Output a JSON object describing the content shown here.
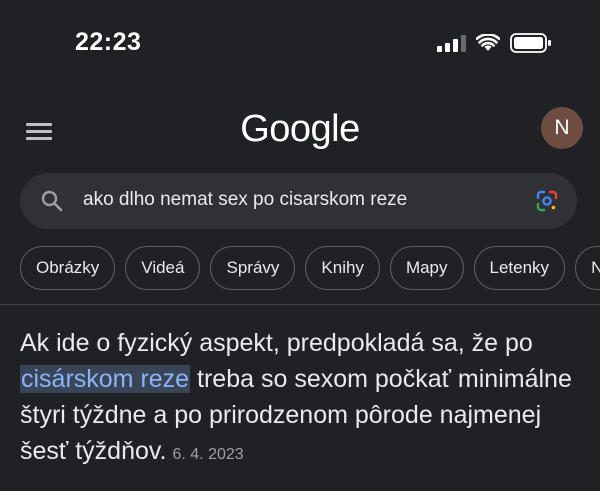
{
  "status_bar": {
    "time": "22:23",
    "icons": [
      "cellular-signal-icon",
      "wifi-icon",
      "battery-icon"
    ]
  },
  "header": {
    "logo_text": "Google",
    "avatar_initial": "N",
    "avatar_color": "#6d4c41",
    "menu_icon": "hamburger-menu-icon"
  },
  "search": {
    "query": "ako dlho nemat sex po cisarskom reze",
    "icons": [
      "search-icon",
      "google-lens-icon"
    ]
  },
  "chips": [
    {
      "label": "Obrázky"
    },
    {
      "label": "Videá"
    },
    {
      "label": "Správy"
    },
    {
      "label": "Knihy"
    },
    {
      "label": "Mapy"
    },
    {
      "label": "Letenky"
    },
    {
      "label": "Nákupy"
    }
  ],
  "snippet": {
    "before": "Ak ide o fyzický aspekt, predpokladá sa, že po ",
    "highlight": "cisárskom reze",
    "after": " treba so sexom počkať minimálne štyri týždne a po prirodzenom pôrode najmenej šesť týždňov.",
    "date": "6. 4. 2023",
    "highlight_color": "#8ab4f8"
  },
  "colors": {
    "background": "#202124",
    "search_bg": "#303134",
    "chip_border": "#5f6368"
  }
}
